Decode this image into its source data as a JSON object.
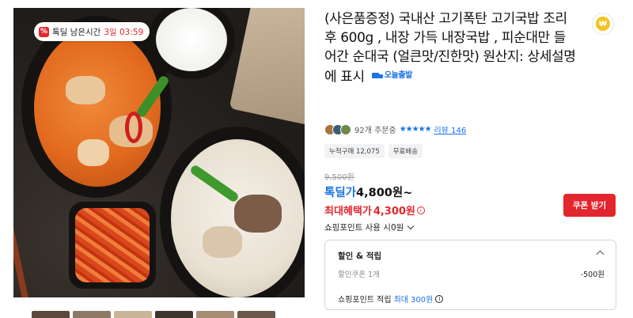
{
  "image": {
    "timer": {
      "icon": "percent-icon",
      "label": "톡딜 남은시간",
      "value": "3일 03:59"
    }
  },
  "product": {
    "title": "(사은품증정) 국내산 고기폭탄 고기국밥 조리후 600g , 내장 가득 내장국밥 , 피순대만 들어간 순대국 (얼큰맛/진한맛) 원산지: 상세설명에 표시",
    "delivery_badge": "오늘출발"
  },
  "coin_button": {
    "icon": "coin-icon",
    "glyph": "₩"
  },
  "reviews": {
    "order_count": "92개 주문중",
    "stars": "★★★★★",
    "review_link": "리뷰 146"
  },
  "tags": [
    "누적구매 12,075",
    "무료배송"
  ],
  "price": {
    "original": "9,500원",
    "deal_label": "톡딜가",
    "deal_value": "4,800원~",
    "best_label": "최대혜택가",
    "best_value": "4,300원",
    "info_glyph": "i"
  },
  "coupon_button": "쿠폰 받기",
  "points_use": "쇼핑포인트 사용 시0원",
  "discount_box": {
    "title": "할인 & 적립",
    "coupon_label": "할인쿠폰 1개",
    "coupon_value": "-500원",
    "points_label": "쇼핑포인트 적립",
    "points_prefix": "최대",
    "points_value": "300원"
  },
  "colors": {
    "accent_red": "#e3262e",
    "accent_blue": "#1a73e8"
  }
}
